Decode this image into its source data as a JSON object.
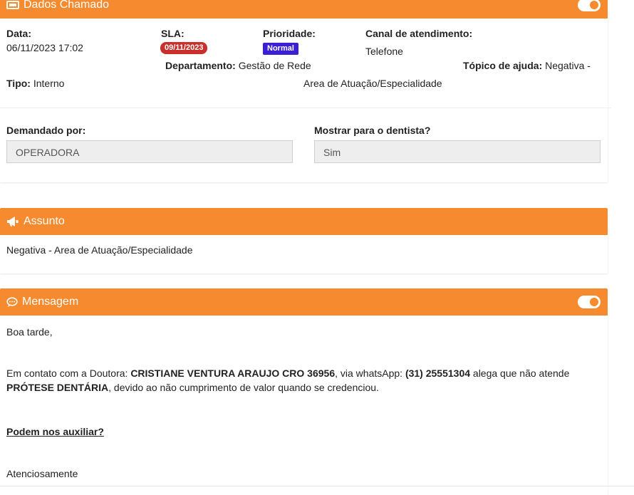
{
  "dados": {
    "header_title": "Dados Chamado",
    "data_label": "Data:",
    "data_value": "06/11/2023 17:02",
    "sla_label": "SLA:",
    "sla_value": "09/11/2023",
    "prioridade_label": "Prioridade:",
    "prioridade_value": "Normal",
    "canal_label": "Canal de atendimento:",
    "canal_value": "Telefone",
    "departamento_label": "Departamento:",
    "departamento_value": "Gestão de Rede",
    "topico_label": "Tópico de ajuda:",
    "topico_value": "Negativa -",
    "topico_value_cont": "Area de Atuação/Especialidade",
    "tipo_label": "Tipo:",
    "tipo_value": "Interno",
    "demandado_label": "Demandado por:",
    "demandado_value": "OPERADORA",
    "mostrar_label": "Mostrar para o dentista?",
    "mostrar_value": "Sim"
  },
  "assunto": {
    "header_title": "Assunto",
    "text": "Negativa - Area de Atuação/Especialidade"
  },
  "mensagem": {
    "header_title": "Mensagem",
    "greeting": "Boa tarde,",
    "p1_a": "Em contato com a Doutora: ",
    "p1_name": "CRISTIANE VENTURA ARAUJO CRO 36956",
    "p1_b": ", via whatsApp: ",
    "p1_phone": "(31) 25551304",
    "p1_c": " alega que não atende ",
    "p1_service": "PRÓTESE DENTÁRIA",
    "p1_d": ", devido ao não cumprimento de valor quando se credenciou.",
    "question": "Podem nos auxiliar?",
    "closing": "Atenciosamente"
  },
  "colors": {
    "accent": "#f58a2f",
    "sla_badge": "#c9302c",
    "priority_badge": "#3b1fd6"
  }
}
